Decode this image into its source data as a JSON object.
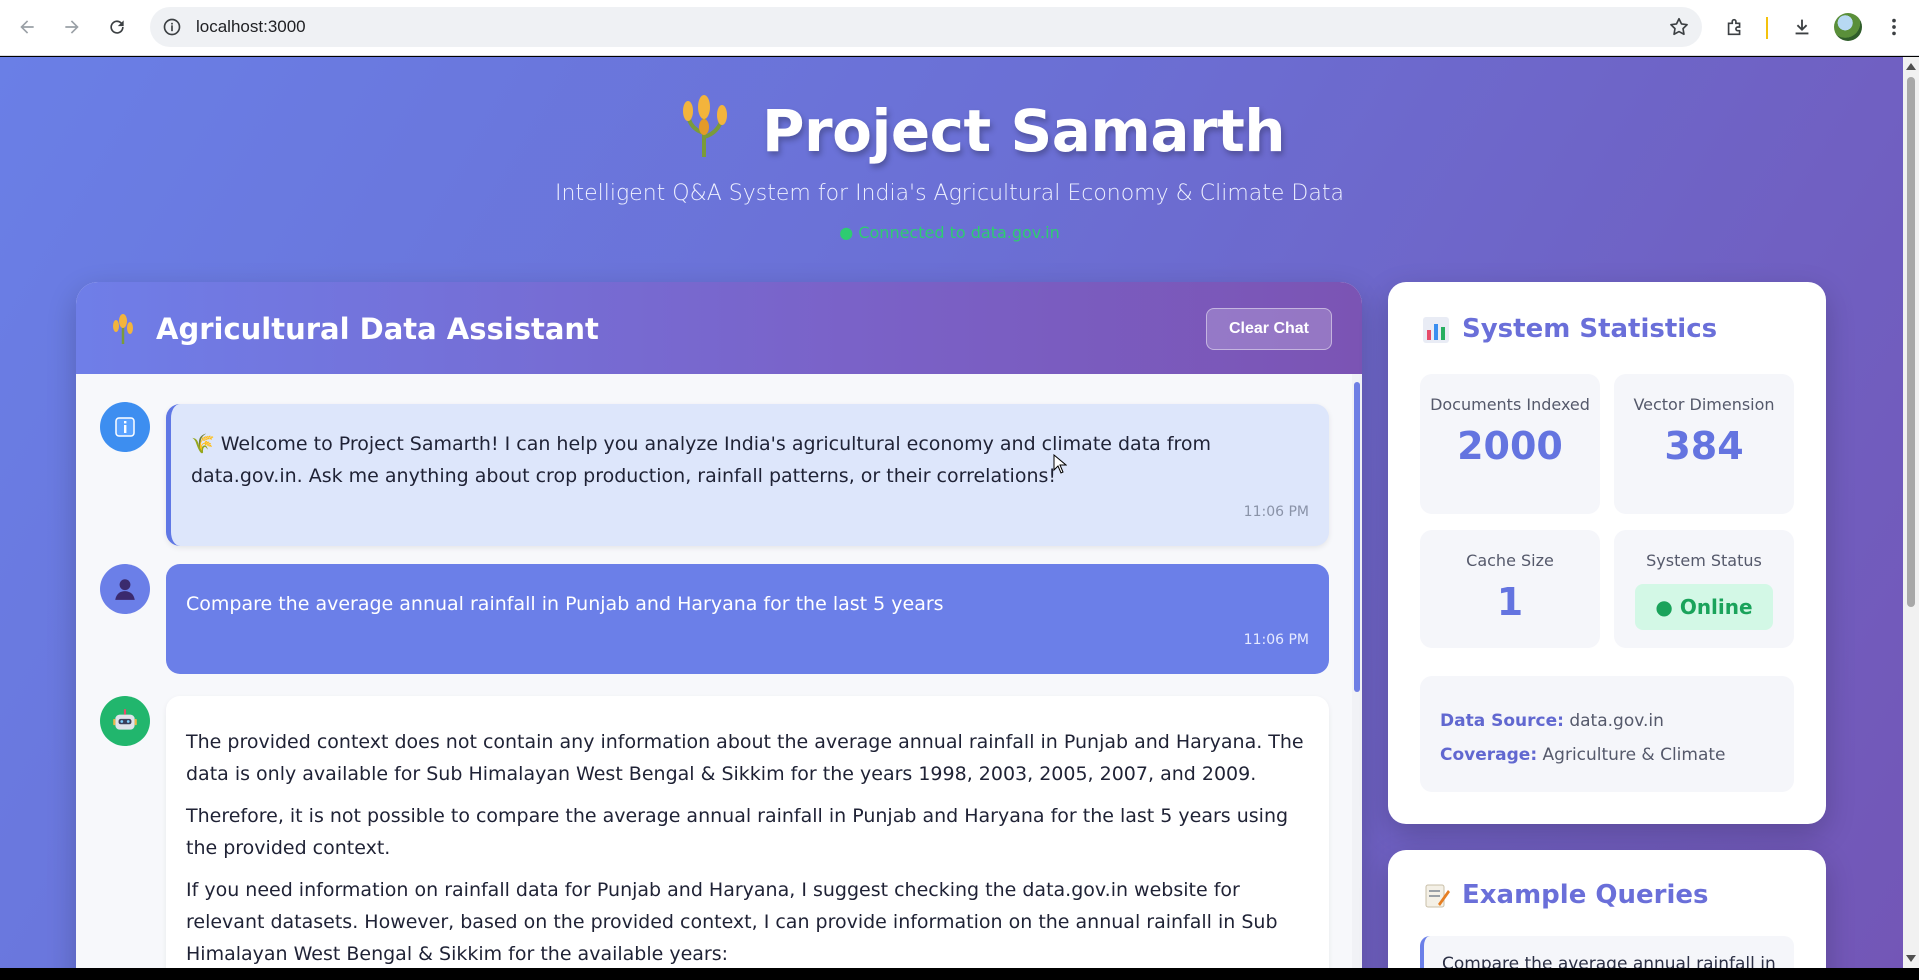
{
  "browser": {
    "url": "localhost:3000"
  },
  "hero": {
    "title": "Project Samarth",
    "subtitle": "Intelligent Q&A System for India's Agricultural Economy & Climate Data",
    "status": "● Connected to data.gov.in"
  },
  "chat": {
    "title": "Agricultural Data Assistant",
    "clear_label": "Clear Chat",
    "messages": [
      {
        "role": "system",
        "text": "🌾 Welcome to Project Samarth! I can help you analyze India's agricultural economy and climate data from data.gov.in. Ask me anything about crop production, rainfall patterns, or their correlations!",
        "time": "11:06 PM"
      },
      {
        "role": "user",
        "text": "Compare the average annual rainfall in Punjab and Haryana for the last 5 years",
        "time": "11:06 PM"
      },
      {
        "role": "bot",
        "paragraphs": [
          "The provided context does not contain any information about the average annual rainfall in Punjab and Haryana. The data is only available for Sub Himalayan West Bengal & Sikkim for the years 1998, 2003, 2005, 2007, and 2009.",
          "Therefore, it is not possible to compare the average annual rainfall in Punjab and Haryana for the last 5 years using the provided context.",
          "If you need information on rainfall data for Punjab and Haryana, I suggest checking the data.gov.in website for relevant datasets. However, based on the provided context, I can provide information on the annual rainfall in Sub Himalayan West Bengal & Sikkim for the available years:"
        ]
      }
    ]
  },
  "stats": {
    "title": "System Statistics",
    "documents_label": "Documents Indexed",
    "documents_value": "2000",
    "vector_label": "Vector Dimension",
    "vector_value": "384",
    "cache_label": "Cache Size",
    "cache_value": "1",
    "status_label": "System Status",
    "status_value": "● Online",
    "source_label": "Data Source:",
    "source_value": "data.gov.in",
    "coverage_label": "Coverage:",
    "coverage_value": "Agriculture & Climate"
  },
  "examples": {
    "title": "Example Queries",
    "first": "Compare the average annual rainfall in"
  },
  "colors": {
    "accent": "#6b7fe8",
    "online": "#1aa35b",
    "connected": "#2ecc71"
  }
}
